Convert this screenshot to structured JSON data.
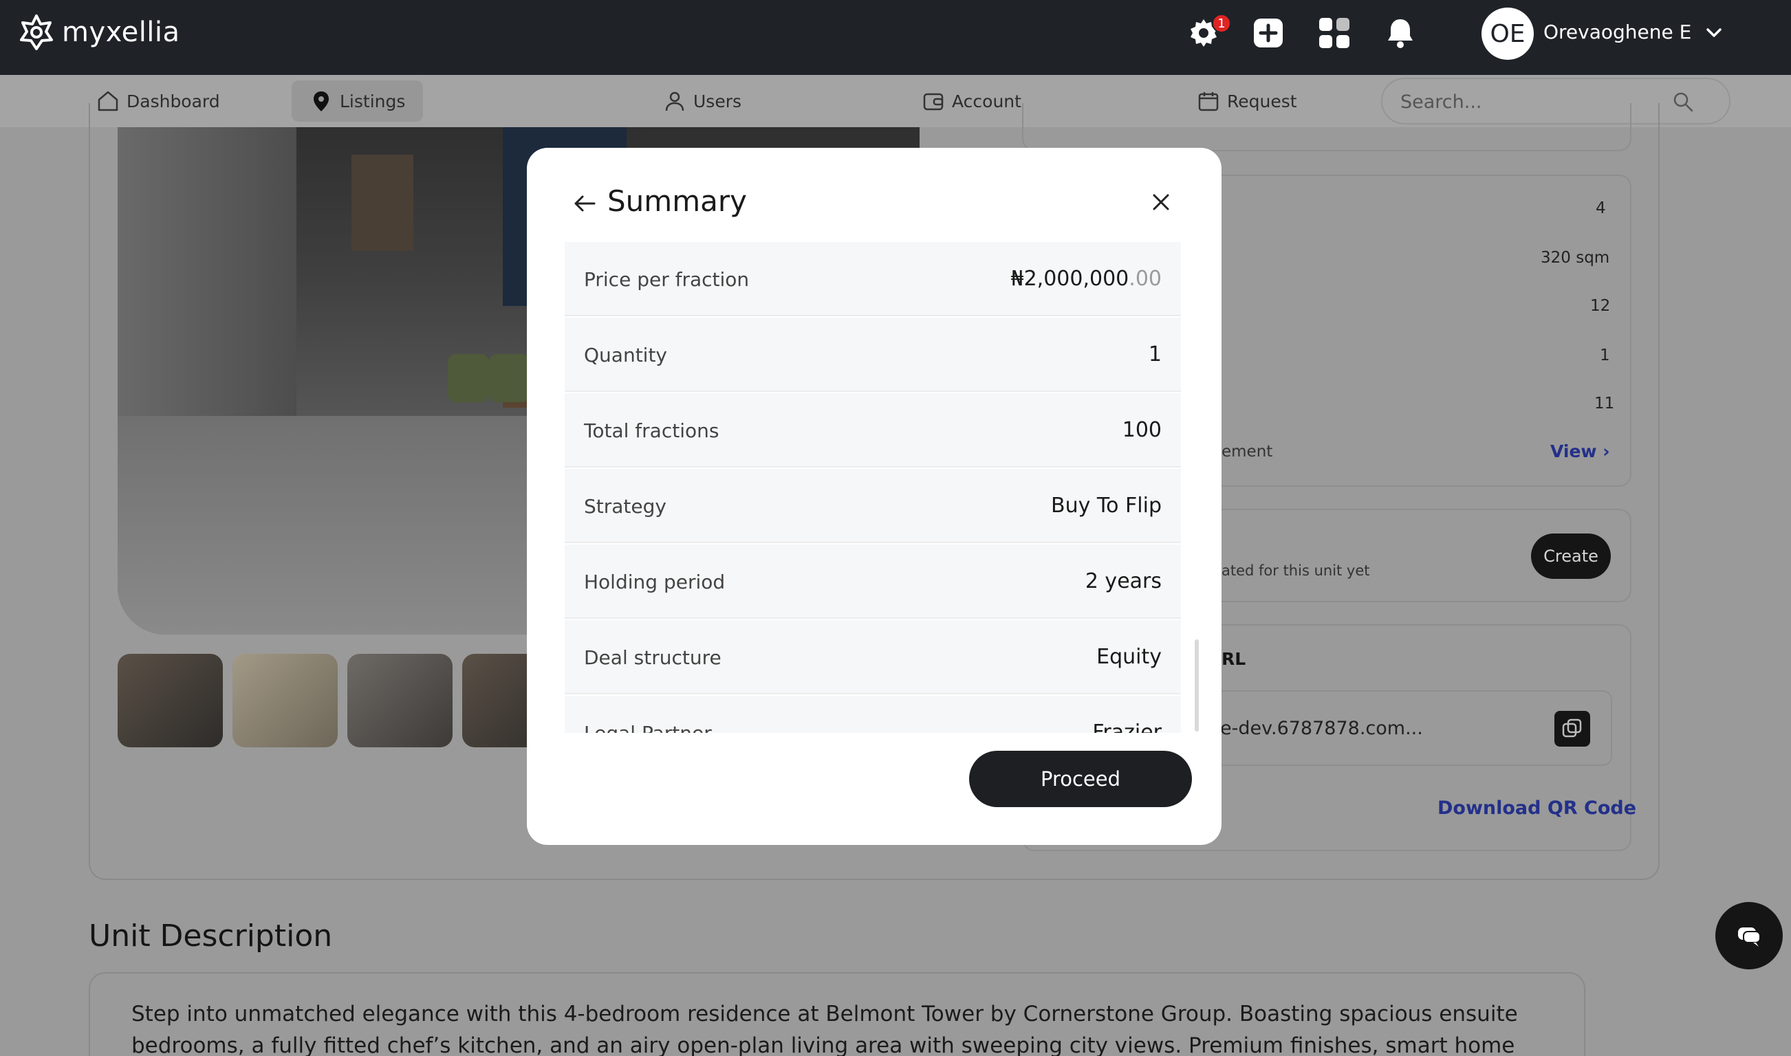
{
  "app": {
    "brand": "myxellia",
    "notification_count": "1",
    "user_initials": "OE",
    "user_name": "Orevaoghene E"
  },
  "nav": {
    "items": [
      {
        "label": "Dashboard",
        "icon": "home-icon"
      },
      {
        "label": "Listings",
        "icon": "location-pin-icon",
        "active": true
      },
      {
        "label": "Users",
        "icon": "user-icon"
      },
      {
        "label": "Account",
        "icon": "wallet-icon"
      },
      {
        "label": "Request",
        "icon": "calendar-icon"
      }
    ],
    "search_placeholder": "Search..."
  },
  "details": {
    "values": [
      "4",
      "320 sqm",
      "12",
      "1",
      "11"
    ],
    "partial_label": "ement",
    "view_link": "View ›",
    "no_item_text": "ated for this unit yet",
    "create_label": "Create",
    "url_section_label": "RL",
    "url_text": "e-dev.6787878.com...",
    "qr_link": "Download QR Code"
  },
  "description": {
    "title": "Unit Description",
    "text": "Step into unmatched elegance with this 4-bedroom residence at Belmont Tower by Cornerstone Group. Boasting spacious ensuite bedrooms, a fully fitted chef’s kitchen, and an airy open-plan living area with sweeping city views. Premium finishes, smart home features, and private"
  },
  "modal": {
    "title": "Summary",
    "rows": [
      {
        "label": "Price per fraction",
        "value": "₦2,000,000",
        "decimal": ".00"
      },
      {
        "label": "Quantity",
        "value": "1"
      },
      {
        "label": "Total fractions",
        "value": "100"
      },
      {
        "label": "Strategy",
        "value": "Buy To Flip"
      },
      {
        "label": "Holding period",
        "value": "2 years"
      },
      {
        "label": "Deal structure",
        "value": "Equity"
      },
      {
        "label": "Legal Partner",
        "value": "Frazier"
      }
    ],
    "proceed_label": "Proceed"
  },
  "colors": {
    "topbar": "#1f2328",
    "link": "#23308a",
    "badge": "#e02424",
    "button_dark": "#1d1f22"
  }
}
